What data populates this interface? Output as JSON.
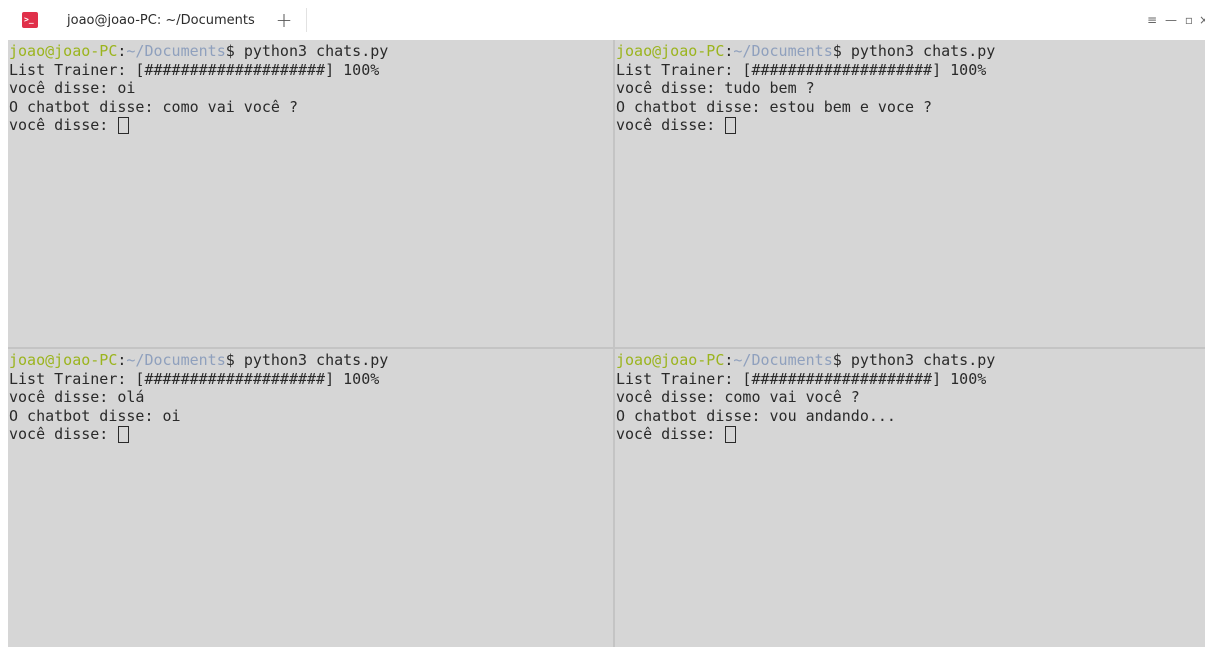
{
  "titlebar": {
    "app_icon_text": ">_",
    "tab_title": "joao@joao-PC: ~/Documents",
    "new_tab": "+",
    "menu": "≡",
    "minimize": "—",
    "maximize": "▫",
    "close": "×"
  },
  "colors": {
    "terminal_bg": "#d6d6d6",
    "user_host": "#9bb41e",
    "path": "#8fa0bd",
    "text": "#2a2a2a",
    "app_icon": "#e0304a"
  },
  "panes": [
    {
      "prompt": {
        "user_host": "joao@joao-PC",
        "colon": ":",
        "path": "~/Documents",
        "symbol": "$ ",
        "command": "python3 chats.py"
      },
      "trainer": "List Trainer: [####################] 100%",
      "user_msg": "você disse: oi",
      "bot_msg": "O chatbot disse: como vai você ?",
      "input_prompt": "você disse: "
    },
    {
      "prompt": {
        "user_host": "joao@joao-PC",
        "colon": ":",
        "path": "~/Documents",
        "symbol": "$ ",
        "command": "python3 chats.py"
      },
      "trainer": "List Trainer: [####################] 100%",
      "user_msg": "você disse: tudo bem ?",
      "bot_msg": "O chatbot disse: estou bem e voce ?",
      "input_prompt": "você disse: "
    },
    {
      "prompt": {
        "user_host": "joao@joao-PC",
        "colon": ":",
        "path": "~/Documents",
        "symbol": "$ ",
        "command": "python3 chats.py"
      },
      "trainer": "List Trainer: [####################] 100%",
      "user_msg": "você disse: olá",
      "bot_msg": "O chatbot disse: oi",
      "input_prompt": "você disse: "
    },
    {
      "prompt": {
        "user_host": "joao@joao-PC",
        "colon": ":",
        "path": "~/Documents",
        "symbol": "$ ",
        "command": "python3 chats.py"
      },
      "trainer": "List Trainer: [####################] 100%",
      "user_msg": "você disse: como vai você ?",
      "bot_msg": "O chatbot disse: vou andando...",
      "input_prompt": "você disse: "
    }
  ]
}
